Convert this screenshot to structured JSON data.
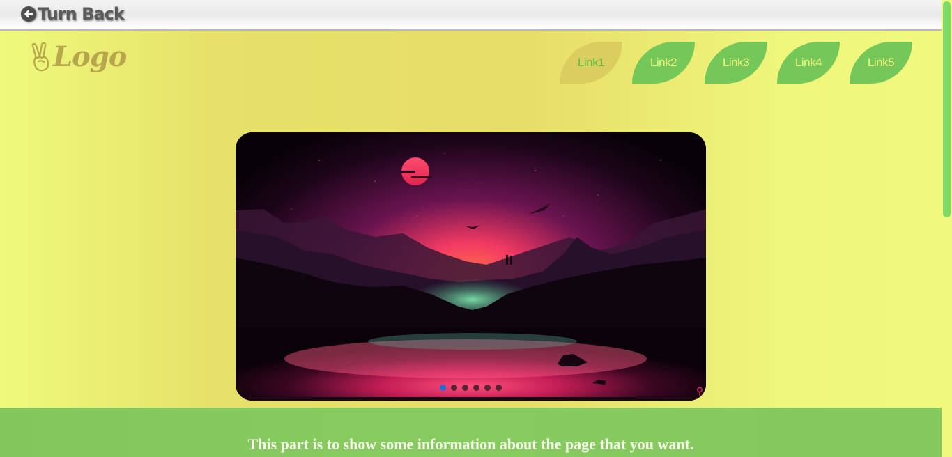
{
  "topbar": {
    "back_label": "Turn Back",
    "back_icon": "arrow-left-circle-icon"
  },
  "logo": {
    "text": "Logo",
    "icon": "peace-hand-icon"
  },
  "nav": {
    "items": [
      {
        "label": "Link1",
        "active": true
      },
      {
        "label": "Link2",
        "active": false
      },
      {
        "label": "Link3",
        "active": false
      },
      {
        "label": "Link4",
        "active": false
      },
      {
        "label": "Link5",
        "active": false
      }
    ]
  },
  "slider": {
    "slide_count": 6,
    "active_index": 0,
    "image": "sunset-mountains-lake"
  },
  "info": {
    "text": "This part is to show some information about the page that you want."
  },
  "colors": {
    "nav_green": "#74c759",
    "nav_active": "#dccd61",
    "nav_text": "#f5f77d",
    "footer_green": "#86ca60",
    "page_yellow": "#e6e16a",
    "dot_active": "#1b6fd6"
  }
}
